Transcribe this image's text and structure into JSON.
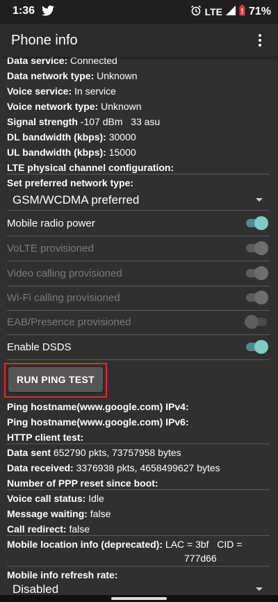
{
  "status_bar": {
    "time": "1:36",
    "network": "LTE",
    "battery": "71%",
    "colors": {
      "battery_low": "#e53935"
    }
  },
  "app_bar": {
    "title": "Phone info"
  },
  "info_rows_top": [
    {
      "label": "Data service:",
      "value": " Connected"
    },
    {
      "label": "Data network type:",
      "value": " Unknown"
    },
    {
      "label": "Voice service:",
      "value": " In service"
    },
    {
      "label": "Voice network type:",
      "value": " Unknown"
    },
    {
      "label": "Signal strength",
      "value": " -107 dBm   33 asu"
    },
    {
      "label": "DL bandwidth (kbps):",
      "value": " 30000"
    },
    {
      "label": "UL bandwidth (kbps):",
      "value": " 15000"
    },
    {
      "label": "LTE physical channel configuration:",
      "value": ""
    }
  ],
  "preferred_network": {
    "label": "Set preferred network type:",
    "value": "GSM/WCDMA preferred"
  },
  "toggles": [
    {
      "label": "Mobile radio power",
      "on": true,
      "enabled": true
    },
    {
      "label": "VoLTE provisioned",
      "on": true,
      "enabled": false
    },
    {
      "label": "Video calling provisioned",
      "on": true,
      "enabled": false
    },
    {
      "label": "Wi-Fi calling provisioned",
      "on": true,
      "enabled": false
    },
    {
      "label": "EAB/Presence provisioned",
      "on": false,
      "enabled": false
    },
    {
      "label": "Enable DSDS",
      "on": true,
      "enabled": true
    }
  ],
  "ping_button": {
    "label": "RUN PING TEST"
  },
  "info_rows_bottom": [
    {
      "label": "Ping hostname(www.google.com) IPv4:",
      "value": ""
    },
    {
      "label": "Ping hostname(www.google.com) IPv6:",
      "value": ""
    },
    {
      "label": "HTTP client test:",
      "value": ""
    },
    {
      "label": "Data sent",
      "value": " 652790 pkts, 73757958 bytes"
    },
    {
      "label": "Data received:",
      "value": " 3376938 pkts, 4658499627 bytes"
    },
    {
      "label": "Number of PPP reset since boot:",
      "value": ""
    },
    {
      "label": "Voice call status:",
      "value": " Idle"
    },
    {
      "label": "Message waiting:",
      "value": " false"
    },
    {
      "label": "Call redirect:",
      "value": " false"
    },
    {
      "label": "Mobile location info (deprecated):",
      "value": " LAC = 3bf   CID ="
    }
  ],
  "location_continuation": "777d66",
  "refresh_rate": {
    "label": "Mobile info refresh rate:",
    "value": "Disabled"
  },
  "colors": {
    "accent": "#80cbc4",
    "thumb_on": "#80cbc4",
    "track_on": "#4f8c87",
    "highlight": "#e0282e"
  }
}
